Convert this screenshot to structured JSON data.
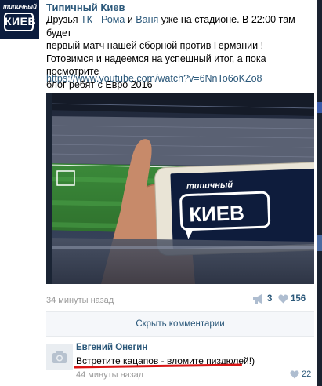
{
  "post": {
    "author": "Типичный Киев",
    "avatar_small_text": "типичный",
    "avatar_big_text": "КИЕВ",
    "text": {
      "l1a": "Друзья ",
      "tk": "ТК",
      "sep1": " - ",
      "roma": "Рома",
      "and": " и ",
      "vanya": "Ваня",
      "l1b": " уже на стадионе. В 22:00 там будет",
      "l2": "первый матч нашей сборной против Германии !",
      "l3": "Готовимся и надеемся на успешный итог, а пока посмотрите",
      "l4": "блог ребят с Евро 2016"
    },
    "url": "https://www.youtube.com/watch?v=6NnTo6oKZo8",
    "photo": {
      "phone_small_text": "типичный",
      "phone_big_text": "КИЕВ"
    },
    "time": "34 минуты назад",
    "shares": "3",
    "likes": "156",
    "hide_comments": "Скрыть комментарии"
  },
  "comment": {
    "author": "Евгений Онегин",
    "text": "Встретите кацапов - вломите пиздюлей!)",
    "time": "44 минуты назад",
    "likes": "22"
  },
  "colors": {
    "link": "#2b587a",
    "underline": "#d91616",
    "meta": "#999999"
  },
  "icons": [
    "camera-icon",
    "megaphone-icon",
    "heart-icon"
  ]
}
